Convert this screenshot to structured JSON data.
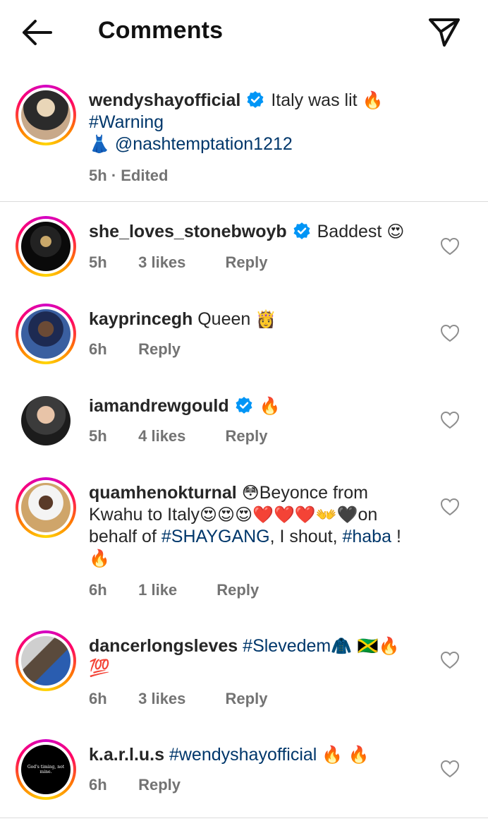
{
  "header": {
    "title": "Comments",
    "back_icon": "arrow-left-icon",
    "send_icon": "paper-plane-icon"
  },
  "caption": {
    "username": "wendyshayofficial",
    "verified": true,
    "text_1": "Italy was lit",
    "emoji_1": "🔥",
    "hashtag": "#Warning",
    "emoji_2": "👗",
    "mention": "@nashtemptation1212",
    "time": "5h",
    "edited": "· Edited"
  },
  "comments": [
    {
      "username": "she_loves_stonebwoyb",
      "verified": true,
      "text": "Baddest",
      "emoji": "😍",
      "time": "5h",
      "likes": "3 likes",
      "reply": "Reply"
    },
    {
      "username": "kayprincegh",
      "verified": false,
      "text": "Queen",
      "emoji": "👸",
      "time": "6h",
      "likes": "",
      "reply": "Reply"
    },
    {
      "username": "iamandrewgould",
      "verified": true,
      "text": "",
      "emoji": "🔥",
      "time": "5h",
      "likes": "4 likes",
      "reply": "Reply"
    },
    {
      "username": "quamhenokturnal",
      "verified": false,
      "emoji_1": "😳",
      "text_1": "Beyonce from",
      "text_2": "Kwahu to Italy",
      "emoji_2": "😍😍😍❤️❤️❤️👐🖤",
      "text_3": "on",
      "text_4": "behalf of",
      "hashtag_1": "#SHAYGANG",
      "text_5": ", I shout,",
      "hashtag_2": "#haba",
      "text_6": " !",
      "emoji_3": "🔥",
      "time": "6h",
      "likes": "1 like",
      "reply": "Reply"
    },
    {
      "username": "dancerlongsleves",
      "verified": false,
      "hashtag": "#Slevedem",
      "emoji_1": "🧥 🇯🇲🔥",
      "emoji_2": "💯",
      "time": "6h",
      "likes": "3 likes",
      "reply": "Reply"
    },
    {
      "username": "k.a.r.l.u.s",
      "verified": false,
      "hashtag": "#wendyshayofficial",
      "emoji": "🔥 🔥",
      "avatar_text": "God's timing, not mine.",
      "time": "6h",
      "likes": "",
      "reply": "Reply"
    }
  ],
  "colors": {
    "hashtag": "#00376b",
    "verified": "#0095f6",
    "meta": "#737373",
    "divider": "#dbdbdb"
  }
}
